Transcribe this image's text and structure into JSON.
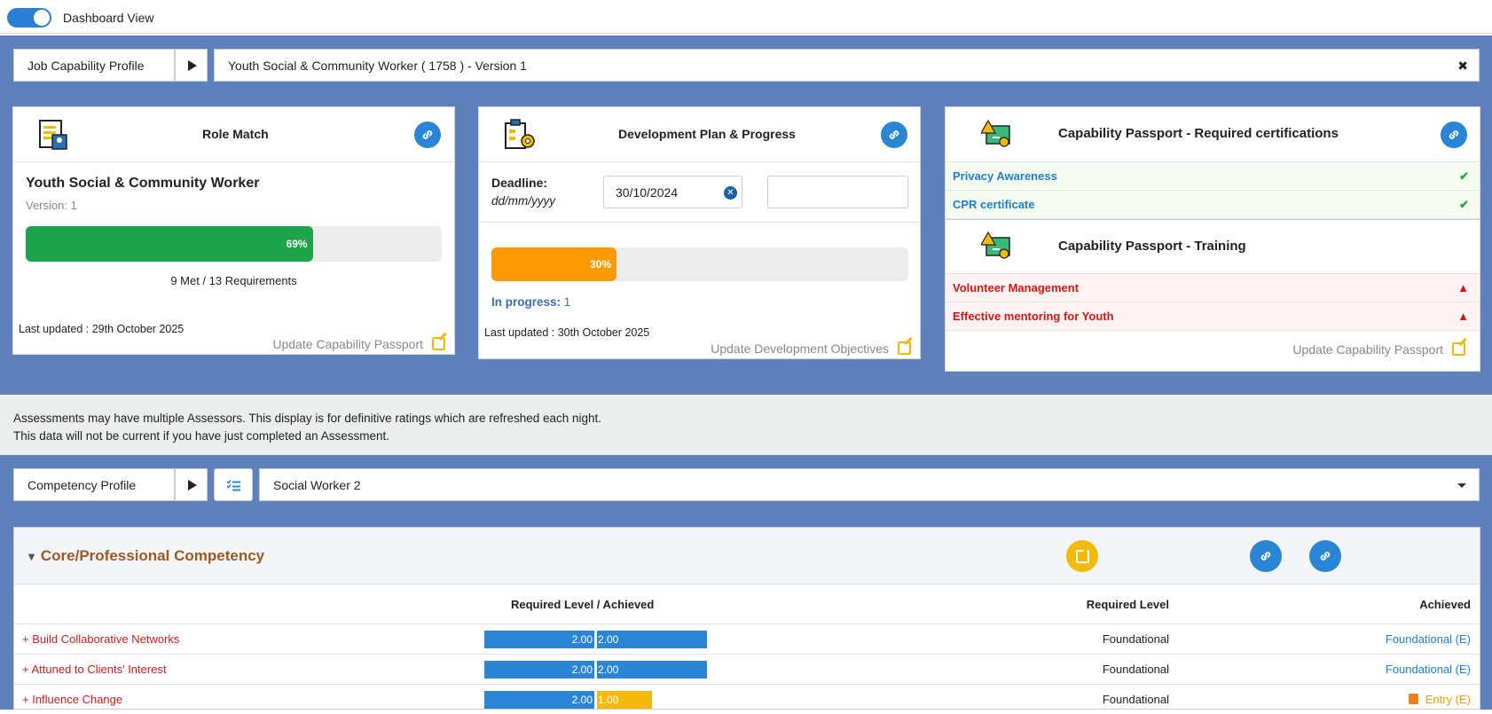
{
  "topbar": {
    "toggle_label": "Dashboard View"
  },
  "job_selector": {
    "label": "Job Capability Profile",
    "value": "Youth Social & Community Worker ( 1758 ) - Version 1",
    "clear_glyph": "✖"
  },
  "role_match": {
    "title": "Role Match",
    "role_name": "Youth Social & Community Worker",
    "version": "Version: 1",
    "progress_percent": 69,
    "progress_label": "69%",
    "requirements": "9 Met / 13 Requirements",
    "last_updated": "Last updated : 29th October 2025",
    "update_link": "Update Capability Passport",
    "progress_color": "#1ea34b"
  },
  "dev_plan": {
    "title": "Development Plan & Progress",
    "deadline_label": "Deadline:",
    "deadline_format": "dd/mm/yyyy",
    "deadline_value": "30/10/2024",
    "progress_percent": 30,
    "progress_label": "30%",
    "status_label": "In progress:",
    "status_count": "1",
    "last_updated": "Last updated : 30th October 2025",
    "update_link": "Update Development Objectives",
    "progress_color": "#fb9a05"
  },
  "passport": {
    "certs_title": "Capability Passport - Required certifications",
    "certs": [
      {
        "name": "Privacy Awareness",
        "status": "ok"
      },
      {
        "name": "CPR certificate",
        "status": "ok"
      }
    ],
    "training_title": "Capability Passport - Training",
    "training": [
      {
        "name": "Volunteer Management",
        "status": "warning"
      },
      {
        "name": "Effective mentoring for Youth",
        "status": "warning"
      }
    ],
    "update_link": "Update Capability Passport"
  },
  "notice": {
    "line1": "Assessments may have multiple Assessors. This display is for definitive ratings which are refreshed each night.",
    "line2": "This data will not be current if you have just completed an Assessment."
  },
  "competency_selector": {
    "label": "Competency Profile",
    "value": "Social Worker 2"
  },
  "competency_section": {
    "title": "Core/Professional Competency",
    "headers": {
      "req_achieved": "Required Level  / Achieved",
      "required": "Required Level",
      "achieved": "Achieved"
    },
    "rows": [
      {
        "name": "+ Build Collaborative Networks",
        "required_value": "2.00",
        "achieved_value": "2.00",
        "achieved_ratio": 1.0,
        "required_level": "Foundational",
        "achieved_level": "Foundational (E)",
        "status": "met"
      },
      {
        "name": "+ Attuned to Clients' Interest",
        "required_value": "2.00",
        "achieved_value": "2.00",
        "achieved_ratio": 1.0,
        "required_level": "Foundational",
        "achieved_level": "Foundational (E)",
        "status": "met"
      },
      {
        "name": "+ Influence Change",
        "required_value": "2.00",
        "achieved_value": "1.00",
        "achieved_ratio": 0.5,
        "required_level": "Foundational",
        "achieved_level": "Entry (E)",
        "status": "below"
      }
    ]
  }
}
